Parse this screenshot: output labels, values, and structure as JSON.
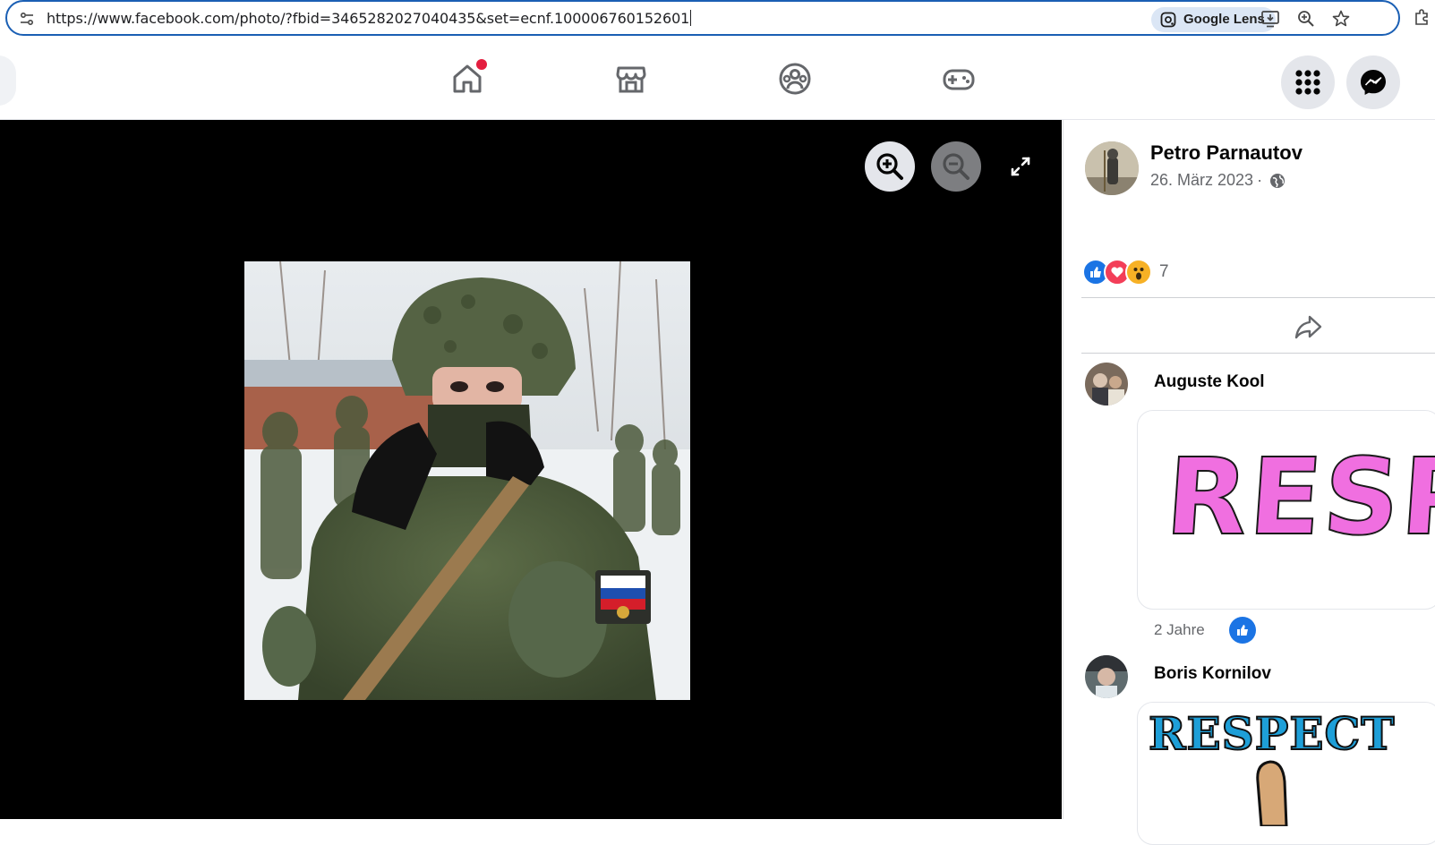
{
  "browser": {
    "url": "https://www.facebook.com/photo/?fbid=3465282027040435&set=ecnf.100006760152601",
    "lens_label": "Google Lens"
  },
  "nav": {
    "tabs": [
      "home",
      "marketplace",
      "groups",
      "gaming"
    ],
    "home_has_notification": true
  },
  "viewer": {
    "controls": [
      "zoom-in",
      "zoom-out",
      "fullscreen"
    ]
  },
  "post": {
    "author": "Petro Parnautov",
    "date": "26. März 2023",
    "separator": "·",
    "reaction_count": "7",
    "reactions": [
      "like",
      "love",
      "wow"
    ]
  },
  "comments": [
    {
      "author": "Auguste Kool",
      "sticker_text": "RESPE",
      "time": "2 Jahre"
    },
    {
      "author": "Boris Kornilov",
      "sticker_text": "RESPECT"
    }
  ],
  "colors": {
    "accent": "#1b74e4",
    "notification": "#e41e3f",
    "viewer_bg": "#000000",
    "sticker_pink": "#f06fe0",
    "sticker_blue": "#1e9fd8"
  }
}
